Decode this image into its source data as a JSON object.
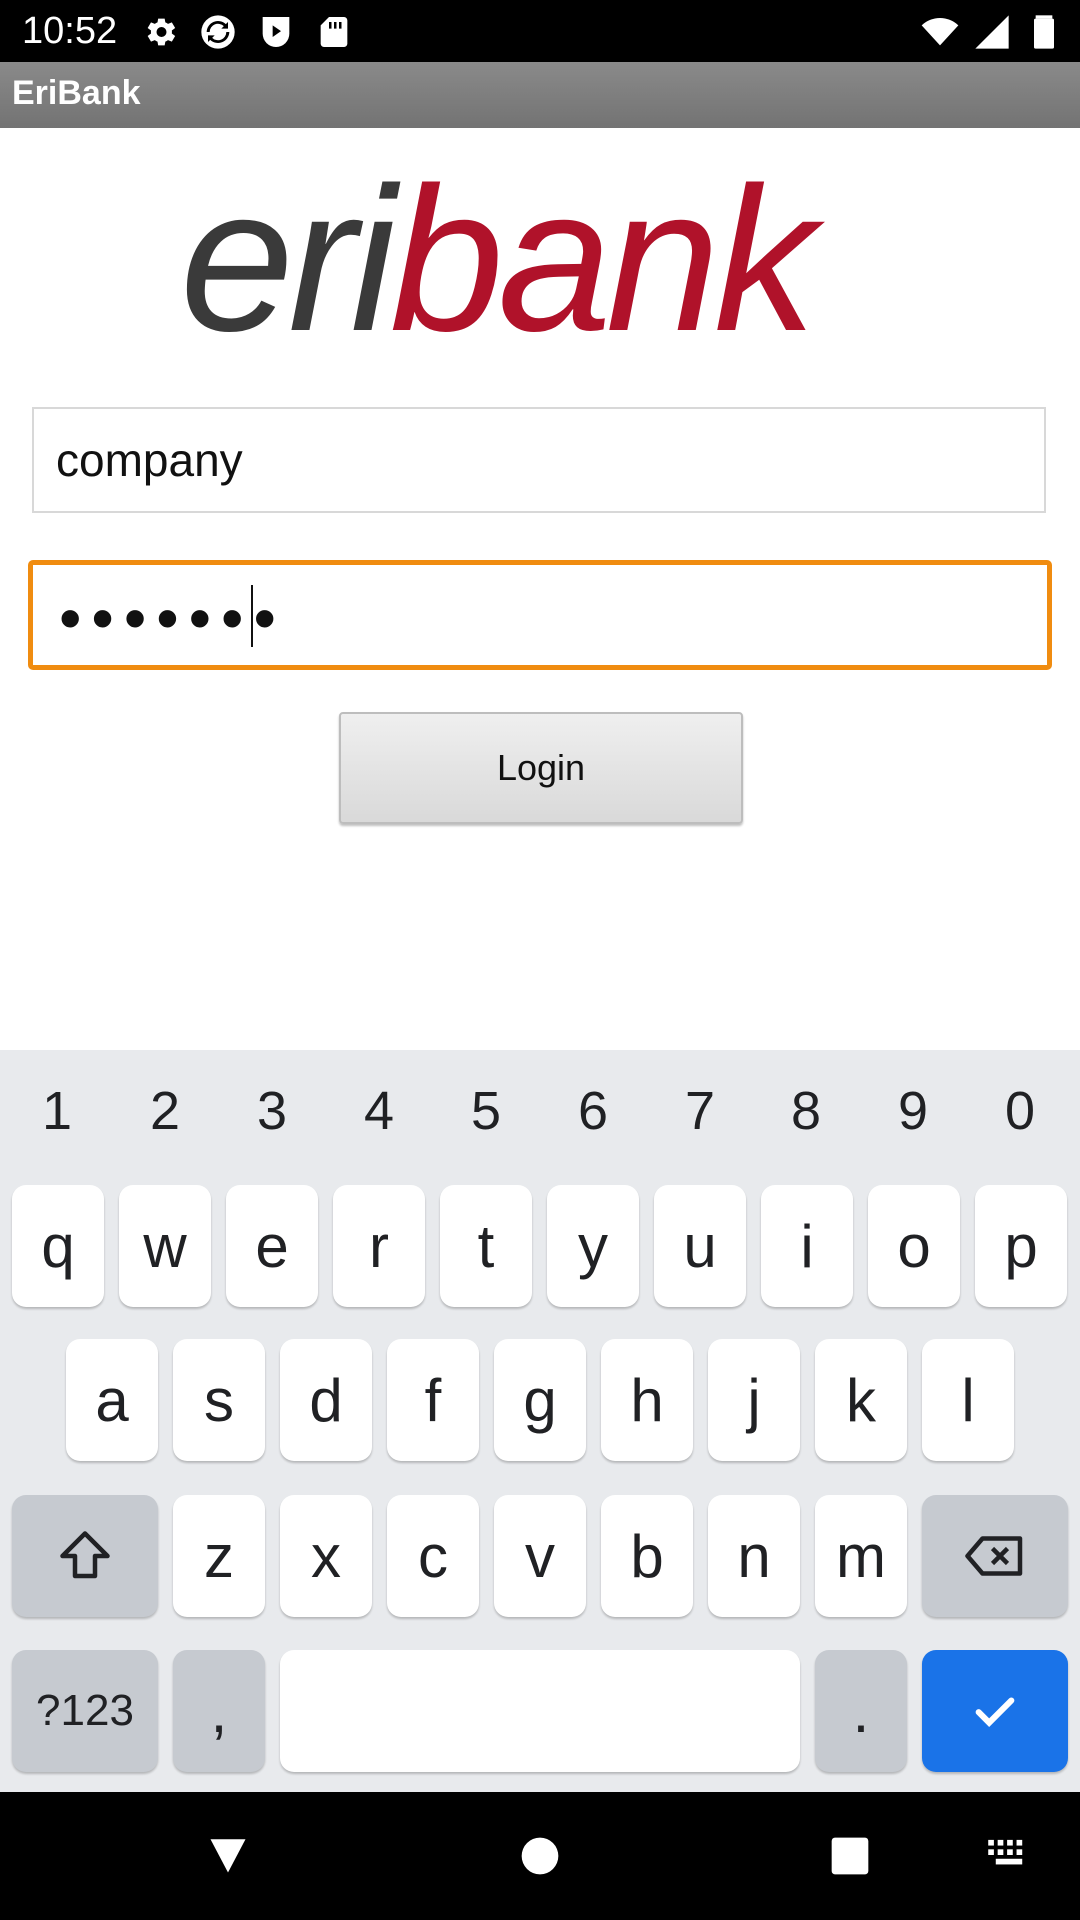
{
  "status_bar": {
    "time": "10:52",
    "left_icons": [
      "gear-icon",
      "sync-icon",
      "play-store-icon",
      "sd-card-icon"
    ],
    "right_icons": [
      "wifi-icon",
      "cell-signal-icon",
      "battery-icon"
    ]
  },
  "app_bar": {
    "title": "EriBank"
  },
  "logo": {
    "text_part1": "eri",
    "text_part2": "bank",
    "colors": {
      "eri": "#3a3a3a",
      "bank": "#b0122a"
    }
  },
  "form": {
    "username_value": "company",
    "password_mask": "•••••••",
    "focused_border_color": "#f08c10",
    "login_label": "Login"
  },
  "keyboard": {
    "number_row": [
      "1",
      "2",
      "3",
      "4",
      "5",
      "6",
      "7",
      "8",
      "9",
      "0"
    ],
    "row1": [
      "q",
      "w",
      "e",
      "r",
      "t",
      "y",
      "u",
      "i",
      "o",
      "p"
    ],
    "row2": [
      "a",
      "s",
      "d",
      "f",
      "g",
      "h",
      "j",
      "k",
      "l"
    ],
    "row3": [
      "z",
      "x",
      "c",
      "v",
      "b",
      "n",
      "m"
    ],
    "symbols_label": "?123",
    "comma": ",",
    "period": ".",
    "shift_icon": "shift-icon",
    "backspace_icon": "backspace-icon",
    "enter_icon": "check-icon",
    "enter_color": "#1a73e8"
  },
  "nav_bar": {
    "buttons": [
      "back-icon",
      "home-icon",
      "recents-icon",
      "keyboard-switch-icon"
    ]
  }
}
